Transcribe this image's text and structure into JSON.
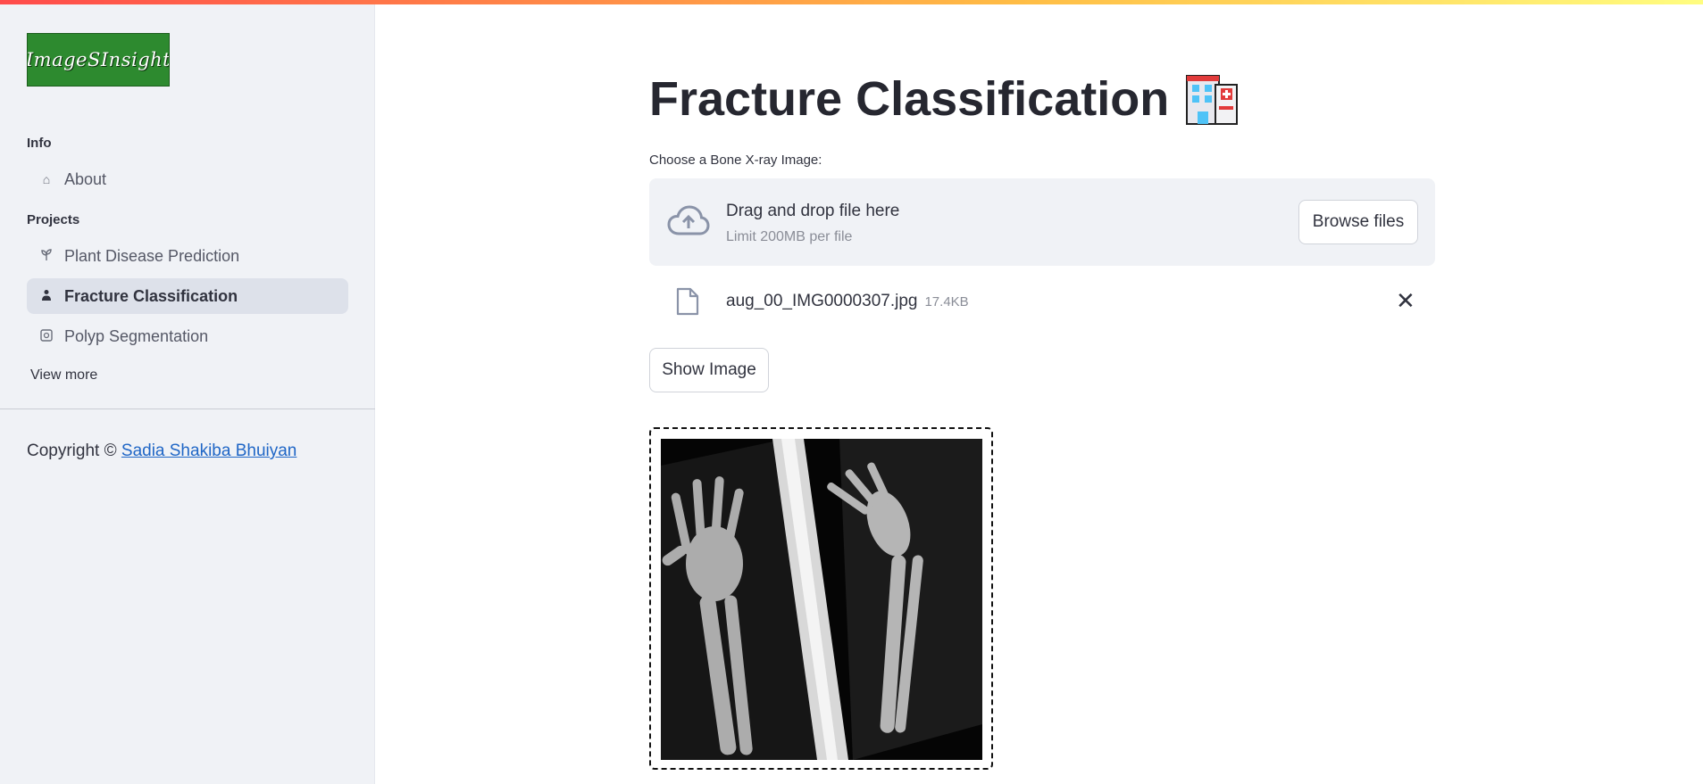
{
  "sidebar": {
    "logo_text": "ImageSInsight",
    "info_label": "Info",
    "projects_label": "Projects",
    "items": [
      {
        "label": "About",
        "icon": "home-icon"
      },
      {
        "label": "Plant Disease Prediction",
        "icon": "sprout-icon"
      },
      {
        "label": "Fracture Classification",
        "icon": "person-icon"
      },
      {
        "label": "Polyp Segmentation",
        "icon": "image-icon"
      }
    ],
    "active_item": "Fracture Classification",
    "view_more": "View more",
    "copyright_prefix": "Copyright ©",
    "copyright_author": "Sadia Shakiba Bhuiyan"
  },
  "main": {
    "title": "Fracture Classification",
    "title_icon": "hospital-icon",
    "uploader_label": "Choose a Bone X-ray Image:",
    "dropzone_title": "Drag and drop file here",
    "dropzone_limit": "Limit 200MB per file",
    "browse_label": "Browse files",
    "file_name": "aug_00_IMG0000307.jpg",
    "file_size": "17.4KB",
    "show_image_label": "Show Image"
  },
  "colors": {
    "accent_gradient": [
      "#ff4b4b",
      "#ffbd45",
      "#fffd80"
    ],
    "sidebar_bg": "#f0f2f6",
    "link": "#1f66c6",
    "logo_bg": "#2d8a2f"
  }
}
